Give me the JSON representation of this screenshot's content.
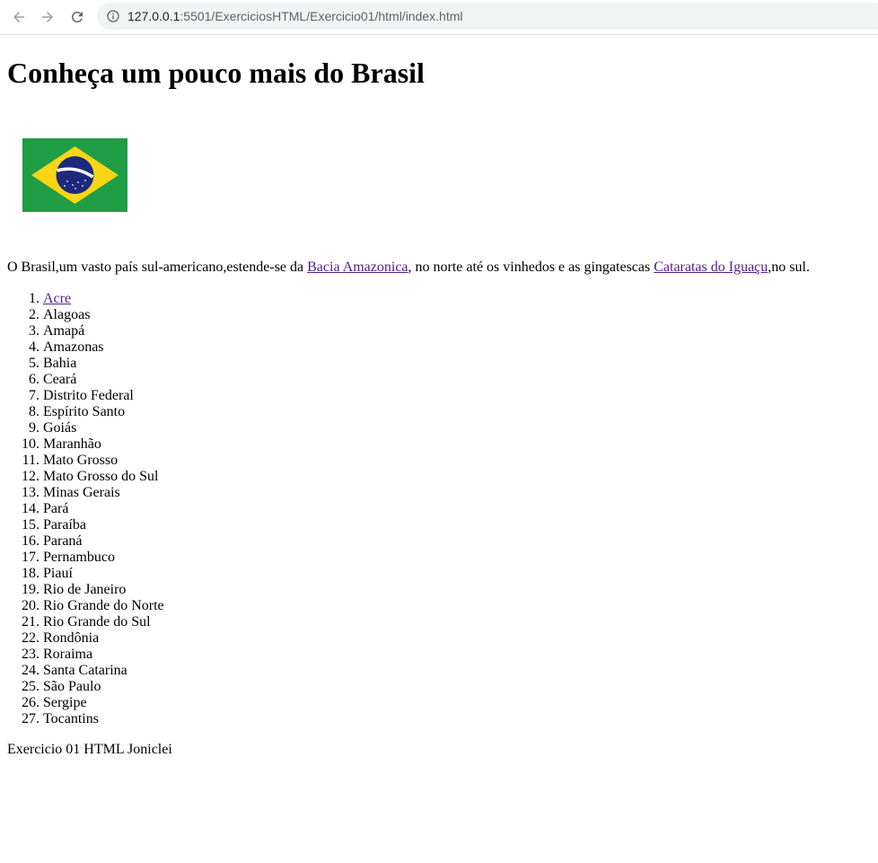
{
  "browser": {
    "url_host": "127.0.0.1",
    "url_rest": ":5501/ExerciciosHTML/Exercicio01/html/index.html",
    "icons": {
      "back": "back-arrow-icon",
      "forward": "forward-arrow-icon",
      "reload": "reload-icon",
      "info": "info-icon"
    }
  },
  "page": {
    "heading": "Conheça um pouco mais do Brasil",
    "flag": {
      "icon": "brazil-flag",
      "colors": {
        "green": "#1f9e45",
        "yellow": "#f9d616",
        "blue": "#1d2a7c",
        "white": "#ffffff"
      }
    },
    "intro": {
      "text1": "O Brasil,um vasto país sul-americano,estende-se da ",
      "link1": "Bacia Amazonica",
      "text2": ", no norte até os vinhedos e as gingatescas ",
      "link2": "Cataratas do Iguaçu",
      "text3": ",no sul."
    },
    "states": [
      "Acre",
      "Alagoas",
      "Amapá",
      "Amazonas",
      "Bahia",
      "Ceará",
      "Distrito Federal",
      "Espírito Santo",
      "Goiás",
      "Maranhão",
      "Mato Grosso",
      "Mato Grosso do Sul",
      "Minas Gerais",
      "Pará",
      "Paraíba",
      "Paraná",
      "Pernambuco",
      "Piauí",
      "Rio de Janeiro",
      "Rio Grande do Norte",
      "Rio Grande do Sul",
      "Rondônia",
      "Roraima",
      "Santa Catarina",
      "São Paulo",
      "Sergipe",
      "Tocantins"
    ],
    "footer": "Exercicio 01 HTML Joniclei",
    "link_color": "#551a8b"
  }
}
